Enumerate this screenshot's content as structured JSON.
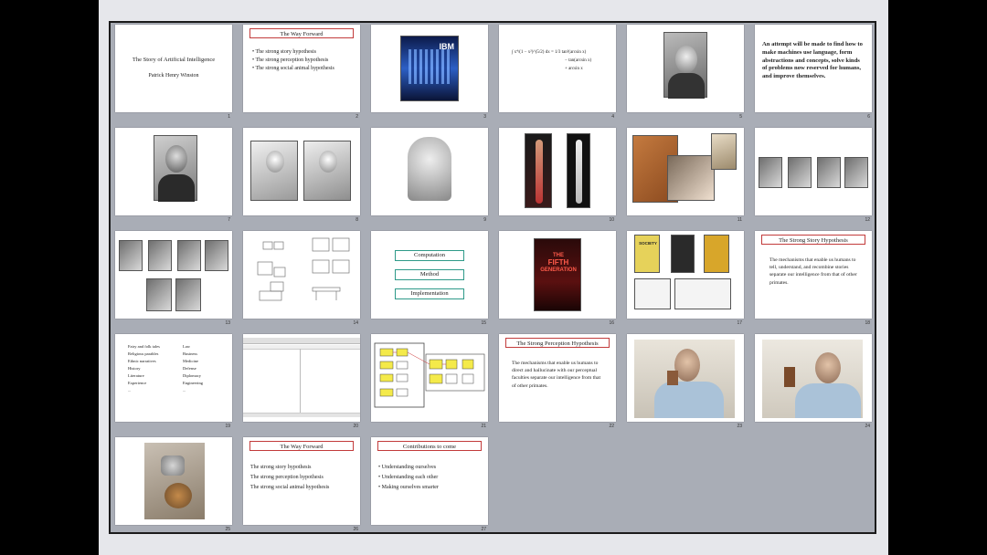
{
  "slides": {
    "s1": {
      "number": "1",
      "title": "The Story of Artificial Intelligence",
      "author": "Patrick Henry Winston"
    },
    "s2": {
      "number": "2",
      "title": "The Way Forward",
      "bullets": [
        "The strong story hypothesis",
        "The strong perception hypothesis",
        "The strong social animal hypothesis"
      ]
    },
    "s3": {
      "number": "3",
      "logo_text": "IBM"
    },
    "s4": {
      "number": "4",
      "formula": [
        "∫ x⁴/(1 − x²)^(5/2) dx = 1/3 tan³(arcsin x)",
        "− tan(arcsin x)",
        "+ arcsin x"
      ]
    },
    "s5": {
      "number": "5"
    },
    "s6": {
      "number": "6",
      "text": "An attempt will be made to find how to make machines use language, form abstractions and concepts, solve kinds of problems now reserved for humans, and improve themselves."
    },
    "s7": {
      "number": "7"
    },
    "s8": {
      "number": "8"
    },
    "s9": {
      "number": "9"
    },
    "s10": {
      "number": "10"
    },
    "s11": {
      "number": "11"
    },
    "s12": {
      "number": "12"
    },
    "s13": {
      "number": "13"
    },
    "s14": {
      "number": "14"
    },
    "s15": {
      "number": "15",
      "boxes": [
        "Computation",
        "Method",
        "Implementation"
      ]
    },
    "s16": {
      "number": "16",
      "cover": [
        "THE",
        "FIFTH",
        "GENERATION"
      ]
    },
    "s17": {
      "number": "17",
      "cover": "SOCIETY"
    },
    "s18": {
      "number": "18",
      "title": "The Strong Story Hypothesis",
      "text": "The mechanisms that enable us humans to tell, understand, and recombine stories separate our intelligence from that of other primates."
    },
    "s19": {
      "number": "19",
      "left": [
        "Fairy and folk tales",
        "Religious parables",
        "Ethnic narratives",
        "History",
        "Literature",
        "Experience",
        "..."
      ],
      "right": [
        "Law",
        "Business",
        "Medicine",
        "Defense",
        "Diplomacy",
        "Engineering",
        "..."
      ]
    },
    "s20": {
      "number": "20"
    },
    "s21": {
      "number": "21"
    },
    "s22": {
      "number": "22",
      "title": "The Strong Perception Hypothesis",
      "text": "The mechanisms that enable us humans to direct and hallucinate with our perceptual faculties separate our intelligence from that of other primates."
    },
    "s23": {
      "number": "23"
    },
    "s24": {
      "number": "24"
    },
    "s25": {
      "number": "25"
    },
    "s26": {
      "number": "26",
      "title": "The Way Forward",
      "lines": [
        "The strong story hypothesis",
        "The strong perception hypothesis",
        "The strong social animal hypothesis"
      ]
    },
    "s27": {
      "number": "27",
      "title": "Contributions to come",
      "bullets": [
        "Understanding ourselves",
        "Understanding each other",
        "Making ourselves smarter"
      ]
    }
  }
}
